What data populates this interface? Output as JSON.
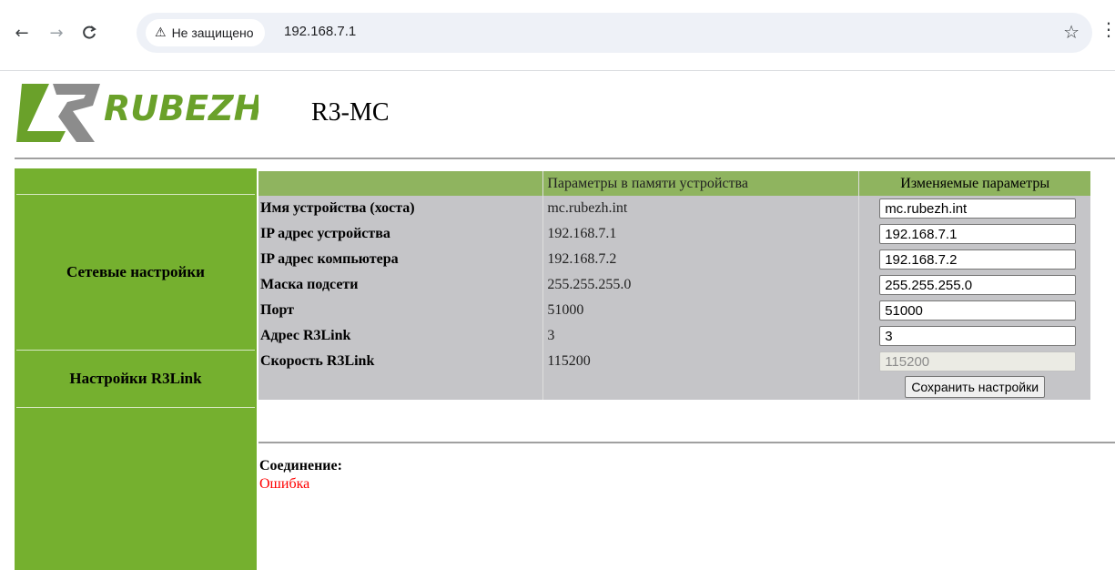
{
  "browser": {
    "back_icon": "←",
    "forward_icon": "→",
    "reload_icon": "C",
    "security_icon": "⚠",
    "security_label": "Не защищено",
    "url": "192.168.7.1",
    "bookmark_icon": "☆",
    "menu_icon": "⋮"
  },
  "header": {
    "logo_text": "RUBEZH",
    "device_title": "R3-MC"
  },
  "sidebar": {
    "items": [
      {
        "label": "Сетевые настройки"
      },
      {
        "label": "Настройки R3Link"
      }
    ]
  },
  "table": {
    "headers": [
      "",
      "Параметры в памяти устройства",
      "Изменяемые параметры"
    ],
    "rows": [
      {
        "name": "Имя устройства (хоста)",
        "stored": "mc.rubezh.int",
        "input": "mc.rubezh.int",
        "disabled": false
      },
      {
        "name": "IP адрес устройства",
        "stored": "192.168.7.1",
        "input": "192.168.7.1",
        "disabled": false
      },
      {
        "name": "IP адрес компьютера",
        "stored": "192.168.7.2",
        "input": "192.168.7.2",
        "disabled": false
      },
      {
        "name": "Маска подсети",
        "stored": "255.255.255.0",
        "input": "255.255.255.0",
        "disabled": false
      },
      {
        "name": "Порт",
        "stored": "51000",
        "input": "51000",
        "disabled": false
      },
      {
        "name": "Адрес R3Link",
        "stored": "3",
        "input": "3",
        "disabled": false
      },
      {
        "name": "Скорость R3Link",
        "stored": "115200",
        "input": "115200",
        "disabled": true
      }
    ],
    "save_button": "Сохранить настройки"
  },
  "connection": {
    "label": "Соединение:",
    "status": "Ошибка",
    "status_color": "#ff0000"
  },
  "colors": {
    "sidebar_green": "#75b02f",
    "header_green": "#8fb45f",
    "row_gray": "#c5c5c8",
    "logo_green": "#6aa12a",
    "logo_gray": "#8c8c8c"
  }
}
